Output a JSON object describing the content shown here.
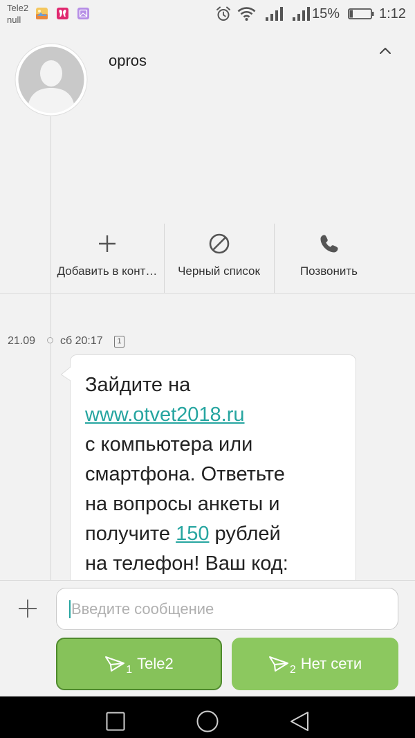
{
  "status_bar": {
    "carrier": "Tele2",
    "carrier_status": "null",
    "notification_icons": [
      "photo-icon",
      "pink-app-icon",
      "image-icon"
    ],
    "status_icons": [
      "alarm-icon",
      "wifi-icon",
      "signal-icon",
      "signal-icon",
      "battery-icon"
    ],
    "battery": "15%",
    "battery_level": 0.15,
    "time": "1:12"
  },
  "contact": {
    "name": "opros",
    "avatar_icon": "person-placeholder-icon"
  },
  "actions": [
    {
      "label": "Добавить в конт…",
      "icon": "plus-icon"
    },
    {
      "label": "Черный список",
      "icon": "block-icon"
    },
    {
      "label": "Позвонить",
      "icon": "phone-icon"
    }
  ],
  "conversation": {
    "date": "21.09",
    "time": "сб 20:17",
    "sim": "1",
    "message": {
      "line1": "Зайдите на",
      "link_url": "www.otvet2018.ru",
      "line3": "с компьютера или",
      "line4": "смартфона. Ответьте",
      "line5": "на вопросы анкеты и",
      "line6_before": "получите ",
      "line6_link": "150",
      "line6_after": " рублей",
      "line7": "на телефон! Ваш код:"
    }
  },
  "composer": {
    "placeholder": "Введите сообщение"
  },
  "send_buttons": [
    {
      "sim": "1",
      "label": "Tele2",
      "selected": true
    },
    {
      "sim": "2",
      "label": "Нет сети",
      "selected": false
    }
  ],
  "colors": {
    "accent": "#26a5a0",
    "btn": "#8cc85f",
    "btn-left": "#86c25a",
    "btn-border": "#4f8a2d",
    "bg": "#f2f2f2",
    "nav": "#000000"
  }
}
